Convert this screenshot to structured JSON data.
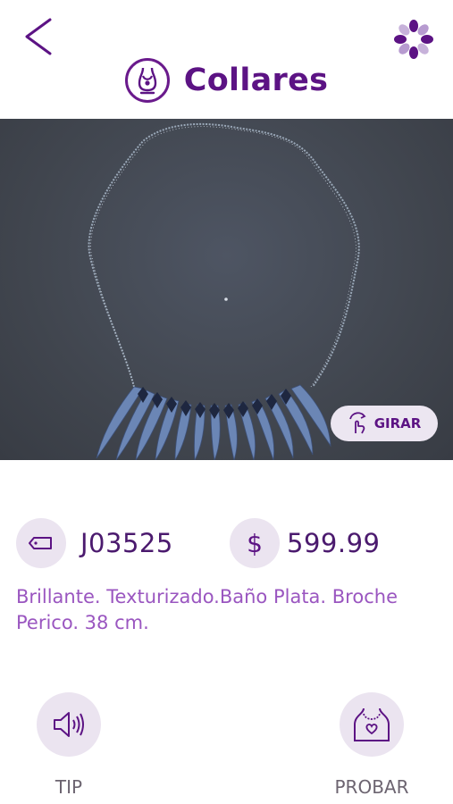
{
  "header": {
    "title": "Collares",
    "back_icon": "chevron-left-icon",
    "menu_icon": "flower-menu-icon",
    "category_icon": "necklace-bust-icon"
  },
  "viewer": {
    "rotate_label": "GIRAR",
    "rotate_icon": "rotate-hand-icon"
  },
  "product": {
    "sku": "J03525",
    "sku_icon": "tag-icon",
    "currency_symbol": "$",
    "price": "599.99",
    "description": "Brillante. Texturizado.Baño Plata. Broche Perico. 38 cm."
  },
  "actions": {
    "tip_label": "TIP",
    "tip_icon": "speaker-icon",
    "try_label": "PROBAR",
    "try_icon": "bust-heart-icon"
  },
  "colors": {
    "primary": "#5c1384",
    "accent_light": "#ebe4f0",
    "description_text": "#9a56c0",
    "viewer_bg": "#41464f"
  }
}
